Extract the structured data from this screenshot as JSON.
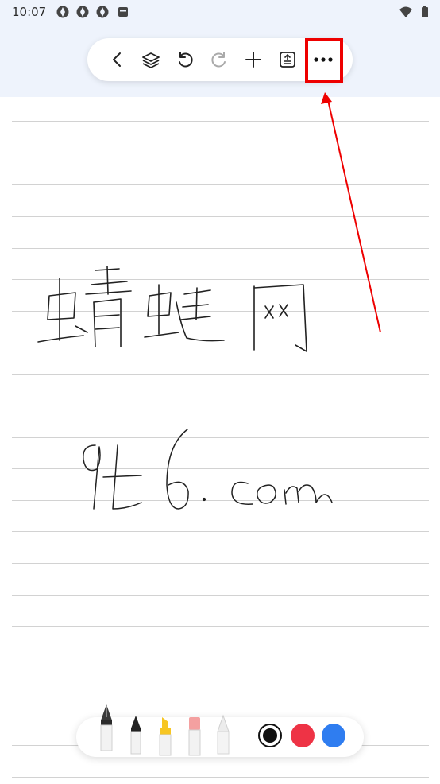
{
  "status_bar": {
    "time": "10:07"
  },
  "toolbar": {
    "buttons": [
      "back",
      "layers",
      "undo",
      "redo",
      "add",
      "page-settings",
      "more"
    ],
    "icons": {
      "back": "chevron-left-icon",
      "layers": "layers-icon",
      "undo": "undo-icon",
      "redo": "redo-icon",
      "add": "plus-icon",
      "page": "page-format-icon",
      "more": "more-horizontal-icon"
    }
  },
  "annotation": {
    "highlight_color": "#ee0000",
    "target": "more-button"
  },
  "canvas": {
    "handwriting": [
      "蜻蜓网",
      "xx",
      "9t6.com"
    ]
  },
  "pen_tools": {
    "tools": [
      "fountain-pen",
      "marker",
      "highlighter",
      "eraser",
      "pencil"
    ],
    "colors": [
      "#111111",
      "#ee3345",
      "#2f7df0"
    ],
    "selected_color": "#111111"
  }
}
